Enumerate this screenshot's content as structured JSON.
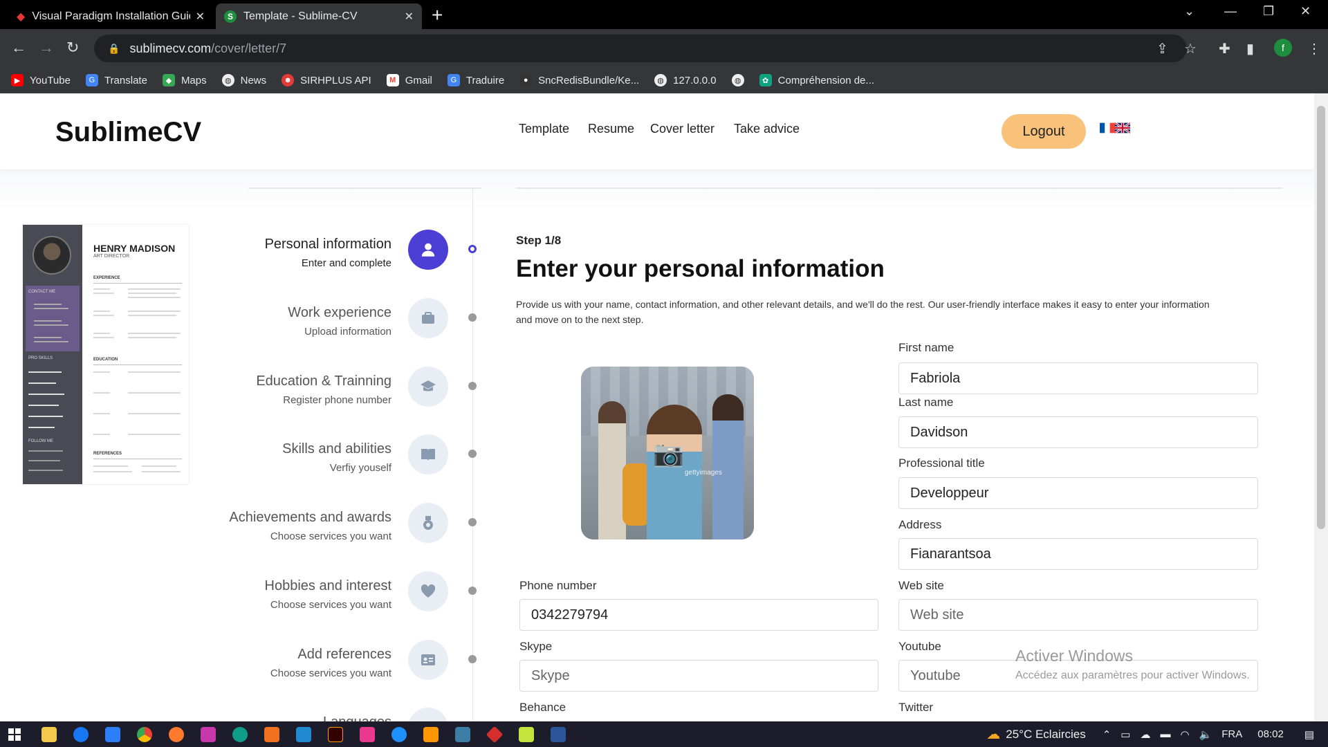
{
  "browser": {
    "tabs": [
      {
        "title": "Visual Paradigm Installation Guid",
        "active": false,
        "favicon_color": "#e53935"
      },
      {
        "title": "Template - Sublime-CV",
        "active": true,
        "favicon_color": "#1e8e3e"
      }
    ],
    "url": {
      "host": "sublimecv.com",
      "path": "/cover/letter/7"
    },
    "bookmarks": [
      {
        "label": "YouTube",
        "icon": "youtube-icon",
        "color": "#ff0000"
      },
      {
        "label": "Translate",
        "icon": "translate-icon",
        "color": "#4285f4"
      },
      {
        "label": "Maps",
        "icon": "maps-icon",
        "color": "#34a853"
      },
      {
        "label": "News",
        "icon": "globe-icon",
        "color": "#555555"
      },
      {
        "label": "SIRHPLUS API",
        "icon": "api-icon",
        "color": "#e53935"
      },
      {
        "label": "Gmail",
        "icon": "gmail-icon",
        "color": "#ea4335"
      },
      {
        "label": "Traduire",
        "icon": "translate-icon",
        "color": "#4285f4"
      },
      {
        "label": "SncRedisBundle/Ke...",
        "icon": "github-icon",
        "color": "#333333"
      },
      {
        "label": "127.0.0.0",
        "icon": "globe-icon",
        "color": "#555555"
      },
      {
        "label": "",
        "icon": "globe-icon",
        "color": "#555555"
      },
      {
        "label": "Compréhension de...",
        "icon": "chatgpt-icon",
        "color": "#10a37f"
      }
    ],
    "profile_initial": "f"
  },
  "header": {
    "logo": "SublimeCV",
    "nav": [
      "Template",
      "Resume",
      "Cover letter",
      "Take advice"
    ],
    "logout_label": "Logout",
    "accent_button": "#f9c27a"
  },
  "preview": {
    "name": "HENRY MADISON",
    "role": "ART DIRECTOR",
    "sections": [
      "EXPERIENCE",
      "EDUCATION",
      "REFERENCES"
    ],
    "side_sections": [
      "CONTACT ME",
      "PRO SKILLS",
      "FOLLOW ME"
    ]
  },
  "steps": [
    {
      "title": "Personal information",
      "subtitle": "Enter and complete",
      "icon": "user-icon",
      "active": true
    },
    {
      "title": "Work experience",
      "subtitle": "Upload information",
      "icon": "briefcase-icon",
      "active": false
    },
    {
      "title": "Education & Trainning",
      "subtitle": "Register phone number",
      "icon": "graduation-cap-icon",
      "active": false
    },
    {
      "title": "Skills and abilities",
      "subtitle": "Verfiy youself",
      "icon": "book-icon",
      "active": false
    },
    {
      "title": "Achievements and awards",
      "subtitle": "Choose services you want",
      "icon": "medal-icon",
      "active": false
    },
    {
      "title": "Hobbies and interest",
      "subtitle": "Choose services you want",
      "icon": "heart-icon",
      "active": false
    },
    {
      "title": "Add references",
      "subtitle": "Choose services you want",
      "icon": "id-card-icon",
      "active": false
    },
    {
      "title": "Languages",
      "subtitle": "",
      "icon": "language-icon",
      "active": false
    }
  ],
  "form": {
    "step_label": "Step 1/8",
    "heading": "Enter your personal information",
    "description": "Provide us with your name, contact information, and other relevant details, and we'll do the rest. Our user-friendly interface makes it easy to enter your information and move on to the next step.",
    "photo_watermark": "gettyimages",
    "fields": {
      "first_name": {
        "label": "First name",
        "value": "Fabriola",
        "placeholder": "First name"
      },
      "last_name": {
        "label": "Last name",
        "value": "Davidson",
        "placeholder": "Last name"
      },
      "professional_title": {
        "label": "Professional title",
        "value": "Developpeur",
        "placeholder": "Professional title"
      },
      "address": {
        "label": "Address",
        "value": "Fianarantsoa",
        "placeholder": "Address"
      },
      "phone": {
        "label": "Phone number",
        "value": "0342279794",
        "placeholder": "Phone number"
      },
      "website": {
        "label": "Web site",
        "value": "",
        "placeholder": "Web site"
      },
      "skype": {
        "label": "Skype",
        "value": "",
        "placeholder": "Skype"
      },
      "youtube": {
        "label": "Youtube",
        "value": "",
        "placeholder": "Youtube"
      },
      "behance": {
        "label": "Behance"
      },
      "twitter": {
        "label": "Twitter"
      }
    },
    "accent": "#4b3fd6"
  },
  "watermark": {
    "title": "Activer Windows",
    "subtitle": "Accédez aux paramètres pour activer Windows."
  },
  "taskbar": {
    "weather": "25°C Eclaircies",
    "language": "FRA",
    "time": "08:02"
  }
}
